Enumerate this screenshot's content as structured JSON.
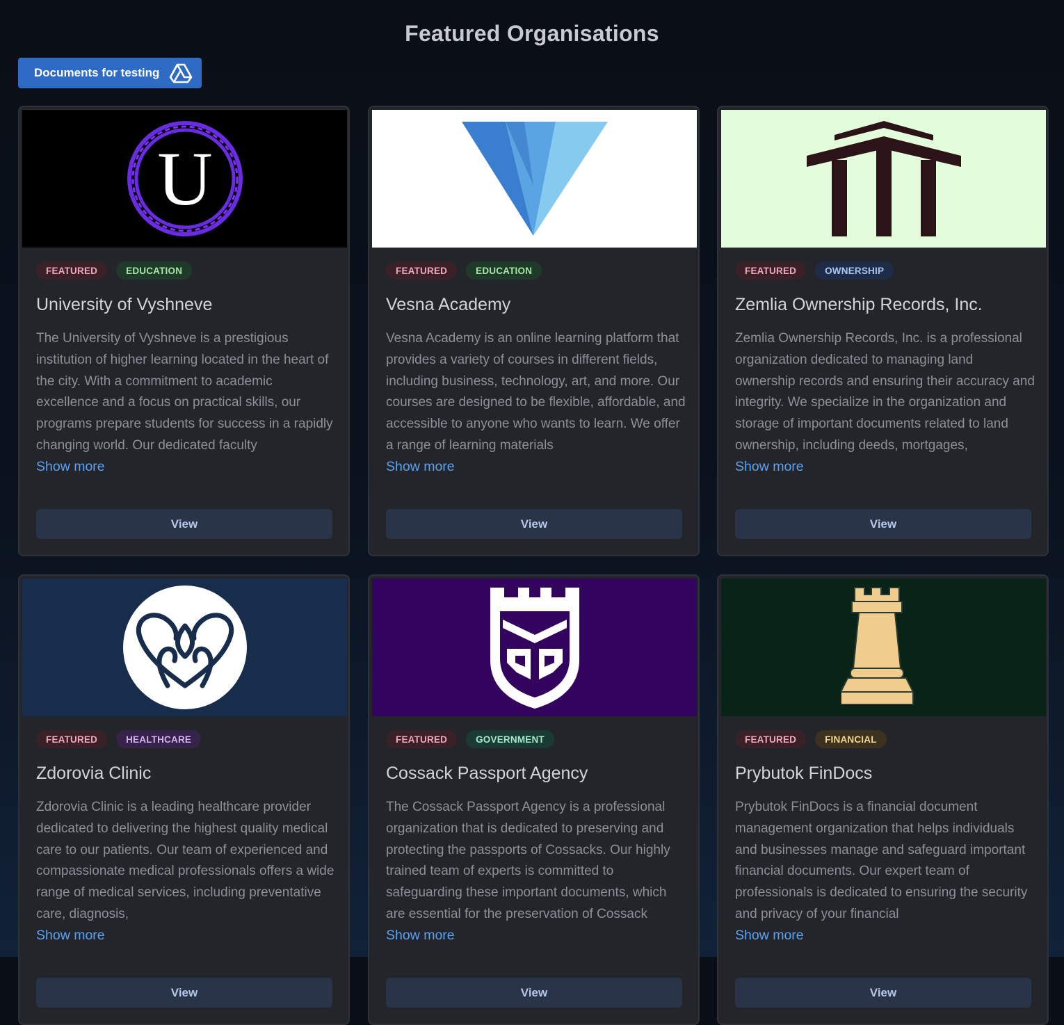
{
  "page": {
    "title": "Featured Organisations",
    "docs_button": "Documents for testing"
  },
  "cards": [
    {
      "tags": [
        "FEATURED",
        "EDUCATION"
      ],
      "name": "University of Vyshneve",
      "description": "The University of Vyshneve is a prestigious institution of higher learning located in the heart of the city. With a commitment to academic excellence and a focus on practical skills, our programs prepare students for success in a rapidly changing world. Our dedicated faculty",
      "show_more": "Show more",
      "view": "View",
      "logo_text": "U",
      "banner_color": "#000000"
    },
    {
      "tags": [
        "FEATURED",
        "EDUCATION"
      ],
      "name": "Vesna Academy",
      "description": "Vesna Academy is an online learning platform that provides a variety of courses in different fields, including business, technology, art, and more. Our courses are designed to be flexible, affordable, and accessible to anyone who wants to learn. We offer a range of learning materials",
      "show_more": "Show more",
      "view": "View",
      "banner_color": "#ffffff"
    },
    {
      "tags": [
        "FEATURED",
        "OWNERSHIP"
      ],
      "name": "Zemlia Ownership Records, Inc.",
      "description": "Zemlia Ownership Records, Inc. is a professional organization dedicated to managing land ownership records and ensuring their accuracy and integrity. We specialize in the organization and storage of important documents related to land ownership, including deeds, mortgages,",
      "show_more": "Show more",
      "view": "View",
      "banner_color": "#e3fcdc"
    },
    {
      "tags": [
        "FEATURED",
        "HEALTHCARE"
      ],
      "name": "Zdorovia Clinic",
      "description": "Zdorovia Clinic is a leading healthcare provider dedicated to delivering the highest quality medical care to our patients. Our team of experienced and compassionate medical professionals offers a wide range of medical services, including preventative care, diagnosis,",
      "show_more": "Show more",
      "view": "View",
      "banner_color": "#182c4c"
    },
    {
      "tags": [
        "FEATURED",
        "GOVERNMENT"
      ],
      "name": "Cossack Passport Agency",
      "description": "The Cossack Passport Agency is a professional organization that is dedicated to preserving and protecting the passports of Cossacks. Our highly trained team of experts is committed to safeguarding these important documents, which are essential for the preservation of Cossack",
      "show_more": "Show more",
      "view": "View",
      "banner_color": "#33045e"
    },
    {
      "tags": [
        "FEATURED",
        "FINANCIAL"
      ],
      "name": "Prybutok FinDocs",
      "description": "Prybutok FinDocs is a financial document management organization that helps individuals and businesses manage and safeguard important financial documents. Our expert team of professionals is dedicated to ensuring the security and privacy of your financial",
      "show_more": "Show more",
      "view": "View",
      "banner_color": "#0a2317"
    }
  ],
  "icons": {
    "docs_button": "google-drive-icon",
    "logos": [
      "university-u-logo",
      "vesna-v-logo",
      "columns-building-logo",
      "hands-heart-logo",
      "castle-book-shield-logo",
      "chess-rook-logo"
    ]
  }
}
